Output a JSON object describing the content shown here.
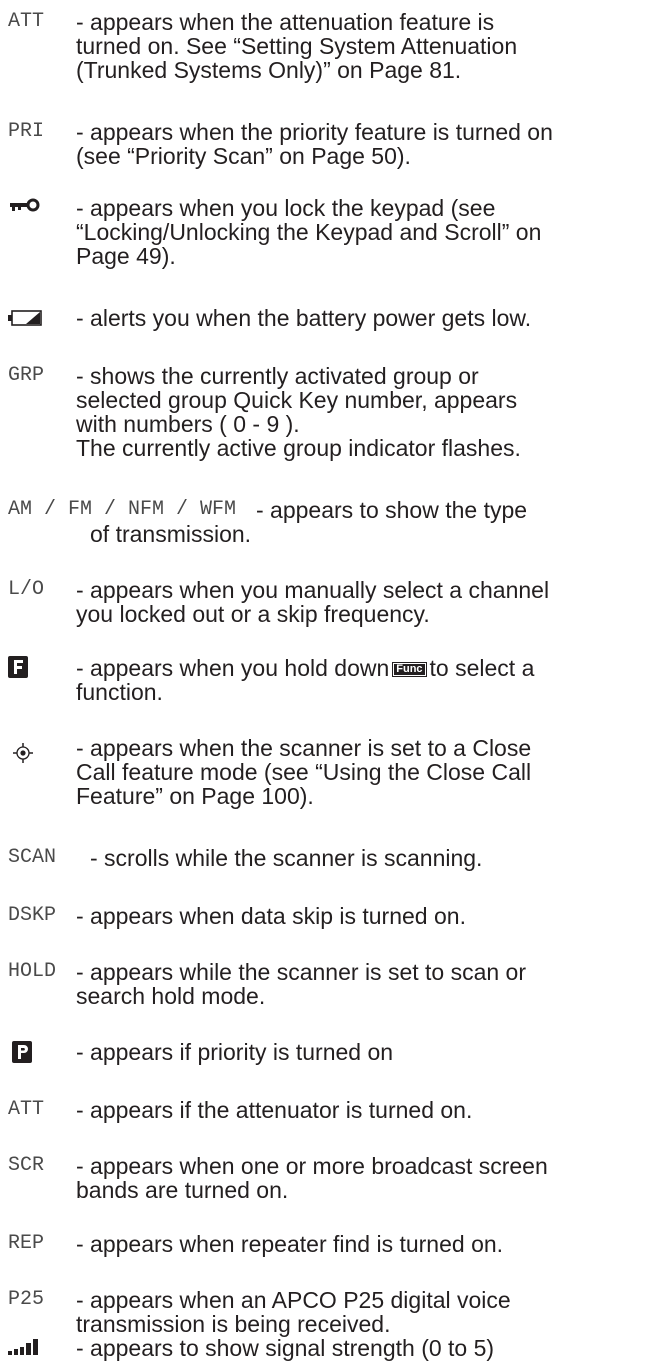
{
  "entries": [
    {
      "term": "ATT",
      "desc": "- appears when the attenuation feature is\n   turned on. See “Setting System Attenuation\n   (Trunked Systems Only)” on Page 81."
    },
    {
      "term": "PRI",
      "desc": "- appears when the priority feature is turned on\n  (see “Priority Scan” on Page 50)."
    },
    {
      "icon": "key-lock-icon",
      "desc": "- appears when you lock the keypad (see\n  “Locking/Unlocking the Keypad and Scroll” on\n  Page 49)."
    },
    {
      "icon": "low-battery-icon",
      "desc": "- alerts you when the battery power gets low."
    },
    {
      "term": "GRP",
      "desc": "- shows the currently activated group or\n   selected group Quick Key number, appears\n   with numbers ( 0 - 9 ).\n   The currently active group indicator flashes."
    },
    {
      "term": "AM / FM / NFM / WFM",
      "desc_line1": "- appears to show the type",
      "desc_line2": "of transmission."
    },
    {
      "term": "L/O",
      "desc": "- appears when you manually select a channel\n  you locked out or a skip frequency."
    },
    {
      "icon": "f-indicator-icon",
      "desc_pre": "- appears when you hold down",
      "key_label": "Func",
      "desc_post": "to select a\n  function."
    },
    {
      "icon": "close-call-icon",
      "desc": "- appears when the scanner is set to a Close\n  Call feature mode (see “Using the Close Call\n  Feature” on Page 100)."
    },
    {
      "term": "SCAN",
      "desc": "- scrolls while the scanner is scanning."
    },
    {
      "term": "DSKP",
      "desc": "- appears when data skip is turned on."
    },
    {
      "term": "HOLD",
      "desc": "- appears while the scanner is set to scan or\n  search hold mode."
    },
    {
      "icon": "p-indicator-icon",
      "desc": "- appears if priority is turned on"
    },
    {
      "term": "ATT",
      "desc": "- appears if the attenuator is turned on."
    },
    {
      "term": "SCR",
      "desc": "- appears when one or more broadcast screen\n  bands are turned on."
    },
    {
      "term": "REP",
      "desc": "- appears when repeater find is turned on."
    },
    {
      "term": "P25",
      "desc": "- appears when an APCO P25 digital voice\n  transmission is being received."
    },
    {
      "icon": "signal-strength-icon",
      "desc": "- appears to show signal strength (0 to 5)"
    }
  ]
}
